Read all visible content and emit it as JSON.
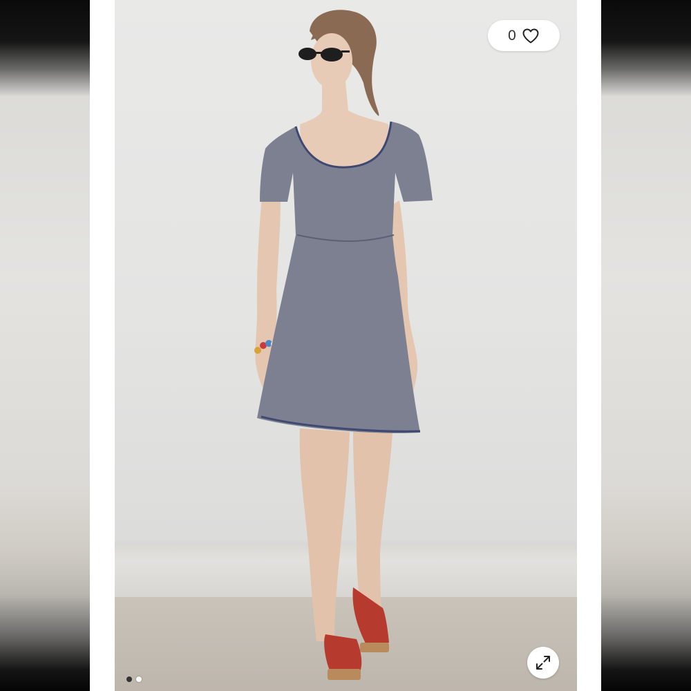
{
  "gallery": {
    "like_count": "0",
    "like_icon": "heart-icon",
    "expand_icon": "expand-arrows-icon",
    "pagination": {
      "total": 2,
      "active": 1
    },
    "colors": {
      "dot_active": "#333333",
      "dot_inactive": "#ffffff",
      "dress": "#7c8090",
      "shoes": "#b73a2e"
    }
  }
}
